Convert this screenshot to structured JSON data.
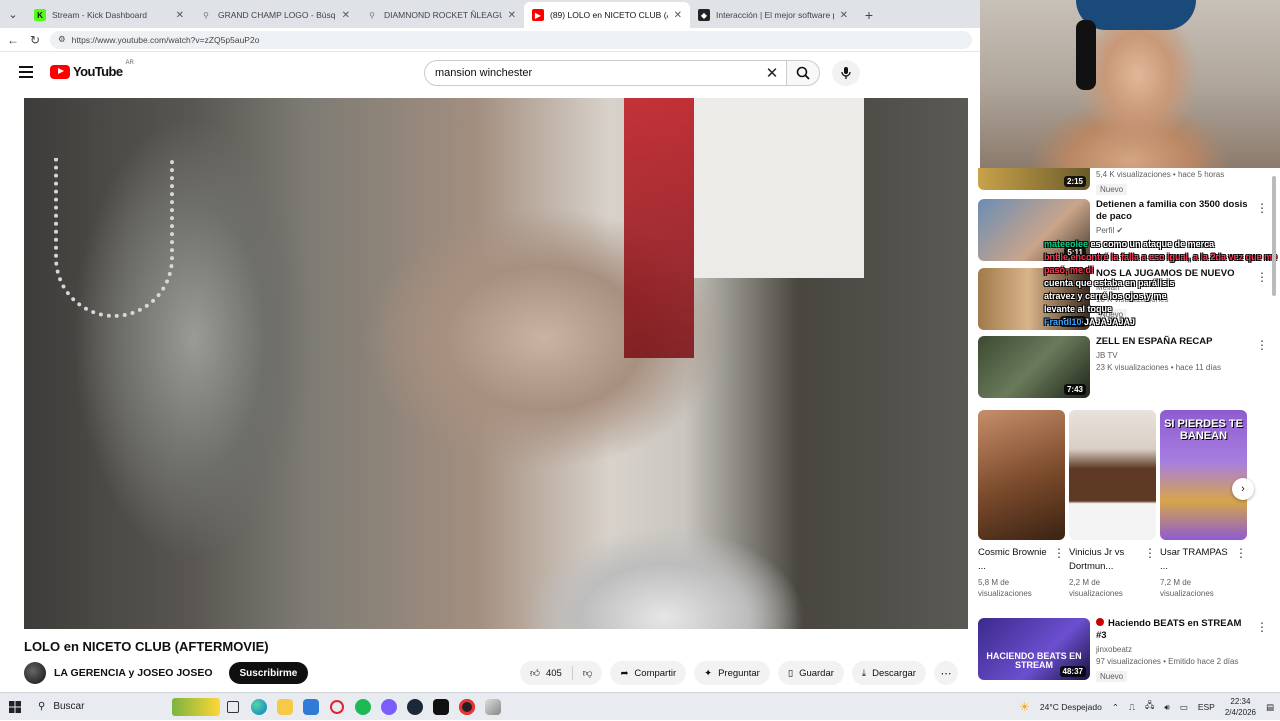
{
  "browser": {
    "tabs": [
      {
        "title": "Stream - Kick Dashboard",
        "fav_color": "#53fc18",
        "active": false
      },
      {
        "title": "GRAND CHAMP LOGO - Búsqueda",
        "fav_color": "#9aa0a6",
        "active": false
      },
      {
        "title": "DIAMNOND ROCKET ÑLEAGUE P",
        "fav_color": "#9aa0a6",
        "active": false
      },
      {
        "title": "(89) LOLO en NICETO CLUB (AFTER",
        "fav_color": "#ff0000",
        "active": true
      },
      {
        "title": "Interacción | El mejor software par",
        "fav_color": "#222222",
        "active": false
      }
    ],
    "url": "https://www.youtube.com/watch?v=zZQ5p5auP2o"
  },
  "youtube": {
    "logo_text": "YouTube",
    "region": "AR",
    "search_query": "mansion winchester"
  },
  "video": {
    "title": "LOLO en NICETO CLUB (AFTERMOVIE)",
    "channel": "LA GERENCIA y JOSEO JOSEO",
    "subscribe_label": "Suscribirme",
    "likes": "405",
    "share_label": "Compartir",
    "ask_label": "Preguntar",
    "save_label": "Guardar",
    "download_label": "Descargar"
  },
  "sidebar": {
    "partial_item": {
      "duration": "2:15",
      "meta": "5,4 K visualizaciones • hace 5 horas",
      "badge": "Nuevo"
    },
    "items": [
      {
        "title": "Detienen a familia con 3500 dosis de paco",
        "channel": "Perfil",
        "meta": "",
        "badge": "",
        "duration": "5:11",
        "colors": [
          "#6b8db5",
          "#c9a58a"
        ]
      },
      {
        "title": "NOS LA JUGAMOS DE NUEVO",
        "channel": "Melian",
        "meta": "18 K visualizaciones",
        "badge": "Nuevo",
        "duration": "19:36",
        "colors": [
          "#a07a4a",
          "#3b2a1e"
        ]
      },
      {
        "title": "ZELL EN ESPAÑA RECAP",
        "channel": "JB TV",
        "meta": "23 K visualizaciones • hace 11 días",
        "badge": "",
        "duration": "7:43",
        "colors": [
          "#3d4a33",
          "#1f261a"
        ]
      }
    ],
    "shorts": [
      {
        "title": "Cosmic Brownie ...",
        "views": "5,8 M de visualizaciones",
        "colors": [
          "#7a4a2c",
          "#c78e6a"
        ]
      },
      {
        "title": "Vinicius Jr vs Dortmun...",
        "views": "2,2 M de visualizaciones",
        "colors": [
          "#5e3a24",
          "#d9cfc4"
        ]
      },
      {
        "title": "Usar TRAMPAS ...",
        "views": "7,2 M de visualizaciones",
        "overlay": "SI PIERDES TE BANEAN",
        "colors": [
          "#8e5bd0",
          "#d6a64a"
        ]
      }
    ],
    "bottom_item": {
      "title": "Haciendo BEATS en STREAM #3",
      "channel": "jinxobeatz",
      "meta": "97 visualizaciones • Emitido hace 2 días",
      "badge": "Nuevo",
      "duration": "48:37",
      "thumb_text": "HACIENDO BEATS EN STREAM"
    }
  },
  "chat_overlay": [
    {
      "user": "mateeolee",
      "text": "es como un ataque de merca"
    },
    {
      "user": "",
      "text": "bnt  le encontré la falla a eso igual, a la 2da vez que me pasó, me di"
    },
    {
      "user": "",
      "text": "cuenta que estaba en parálisis"
    },
    {
      "user": "",
      "text": "atravez y cerré los ojos y me"
    },
    {
      "user": "",
      "text": "levante al toque"
    },
    {
      "user": "Frandi10",
      "text": "JAJAJAJAJ"
    }
  ],
  "taskbar": {
    "search_placeholder": "Buscar",
    "weather": "24°C  Despejado",
    "lang": "ESP",
    "time": "22:34",
    "date": "2/4/2026"
  }
}
